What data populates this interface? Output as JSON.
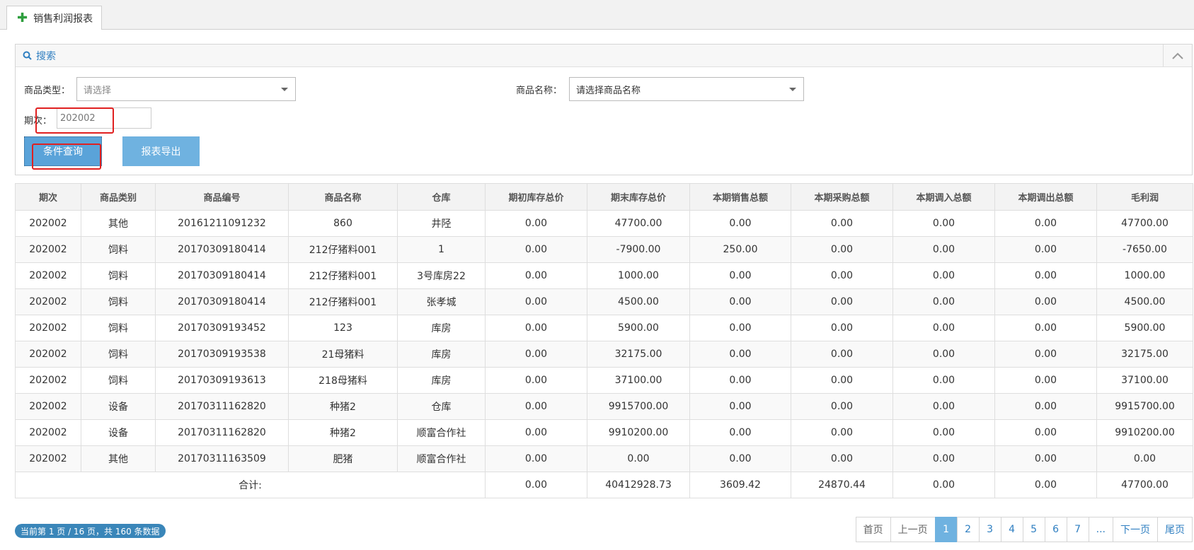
{
  "tab": {
    "label": "销售利润报表"
  },
  "search": {
    "title": "搜索",
    "category_label": "商品类型：",
    "category_value": "请选择",
    "name_label": "商品名称：",
    "name_value": "请选择商品名称",
    "period_label": "期次：",
    "period_value": "202002",
    "query_button": "条件查询",
    "export_button": "报表导出"
  },
  "table": {
    "headers": [
      "期次",
      "商品类别",
      "商品编号",
      "商品名称",
      "仓库",
      "期初库存总价",
      "期末库存总价",
      "本期销售总额",
      "本期采购总额",
      "本期调入总额",
      "本期调出总额",
      "毛利润"
    ],
    "rows": [
      [
        "202002",
        "其他",
        "20161211091232",
        "860",
        "井陉",
        "0.00",
        "47700.00",
        "0.00",
        "0.00",
        "0.00",
        "0.00",
        "47700.00"
      ],
      [
        "202002",
        "饲料",
        "20170309180414",
        "212仔猪料001",
        "1",
        "0.00",
        "-7900.00",
        "250.00",
        "0.00",
        "0.00",
        "0.00",
        "-7650.00"
      ],
      [
        "202002",
        "饲料",
        "20170309180414",
        "212仔猪料001",
        "3号库房22",
        "0.00",
        "1000.00",
        "0.00",
        "0.00",
        "0.00",
        "0.00",
        "1000.00"
      ],
      [
        "202002",
        "饲料",
        "20170309180414",
        "212仔猪料001",
        "张孝城",
        "0.00",
        "4500.00",
        "0.00",
        "0.00",
        "0.00",
        "0.00",
        "4500.00"
      ],
      [
        "202002",
        "饲料",
        "20170309193452",
        "123",
        "库房",
        "0.00",
        "5900.00",
        "0.00",
        "0.00",
        "0.00",
        "0.00",
        "5900.00"
      ],
      [
        "202002",
        "饲料",
        "20170309193538",
        "21母猪料",
        "库房",
        "0.00",
        "32175.00",
        "0.00",
        "0.00",
        "0.00",
        "0.00",
        "32175.00"
      ],
      [
        "202002",
        "饲料",
        "20170309193613",
        "218母猪料",
        "库房",
        "0.00",
        "37100.00",
        "0.00",
        "0.00",
        "0.00",
        "0.00",
        "37100.00"
      ],
      [
        "202002",
        "设备",
        "20170311162820",
        "种猪2",
        "仓库",
        "0.00",
        "9915700.00",
        "0.00",
        "0.00",
        "0.00",
        "0.00",
        "9915700.00"
      ],
      [
        "202002",
        "设备",
        "20170311162820",
        "种猪2",
        "顺富合作社",
        "0.00",
        "9910200.00",
        "0.00",
        "0.00",
        "0.00",
        "0.00",
        "9910200.00"
      ],
      [
        "202002",
        "其他",
        "20170311163509",
        "肥猪",
        "顺富合作社",
        "0.00",
        "0.00",
        "0.00",
        "0.00",
        "0.00",
        "0.00",
        "0.00"
      ]
    ],
    "total_label": "合计:",
    "totals": [
      "0.00",
      "40412928.73",
      "3609.42",
      "24870.44",
      "0.00",
      "0.00",
      "47700.00"
    ]
  },
  "footer": {
    "info": "当前第 1 页 / 16 页，共 160 条数据",
    "first": "首页",
    "prev": "上一页",
    "pages": [
      "1",
      "2",
      "3",
      "4",
      "5",
      "6",
      "7",
      "..."
    ],
    "next": "下一页",
    "last": "尾页"
  }
}
